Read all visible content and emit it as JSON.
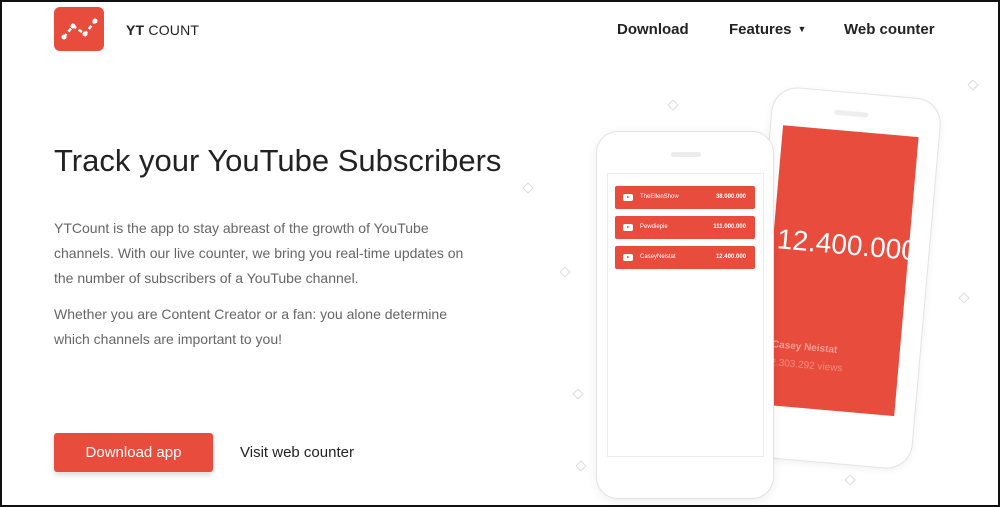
{
  "brand": {
    "name_bold": "YT",
    "name_rest": " COUNT"
  },
  "nav": {
    "download": "Download",
    "features": "Features",
    "web_counter": "Web counter"
  },
  "hero": {
    "title": "Track your YouTube Subscribers",
    "paragraph1": "YTCount is the app to stay abreast of the growth of YouTube channels. With our live counter, we bring you real-time updates on the number of subscribers of a YouTube channel.",
    "paragraph2": "Whether you are Content Creator or a fan: you alone determine which channels are important to you!",
    "download_button": "Download app",
    "web_link": "Visit web counter"
  },
  "phone_back": {
    "count": "12.400.000",
    "channel": "Casey Neistat",
    "views": "2.303.292 views"
  },
  "phone_front": {
    "rows": [
      {
        "name": "TheEllenShow",
        "count": "38.000.000"
      },
      {
        "name": "Pewdiepie",
        "count": "111.000.000"
      },
      {
        "name": "CaseyNeistat",
        "count": "12.400.000"
      }
    ]
  },
  "colors": {
    "accent": "#e84c3d",
    "text": "#222222",
    "muted": "#666666"
  }
}
